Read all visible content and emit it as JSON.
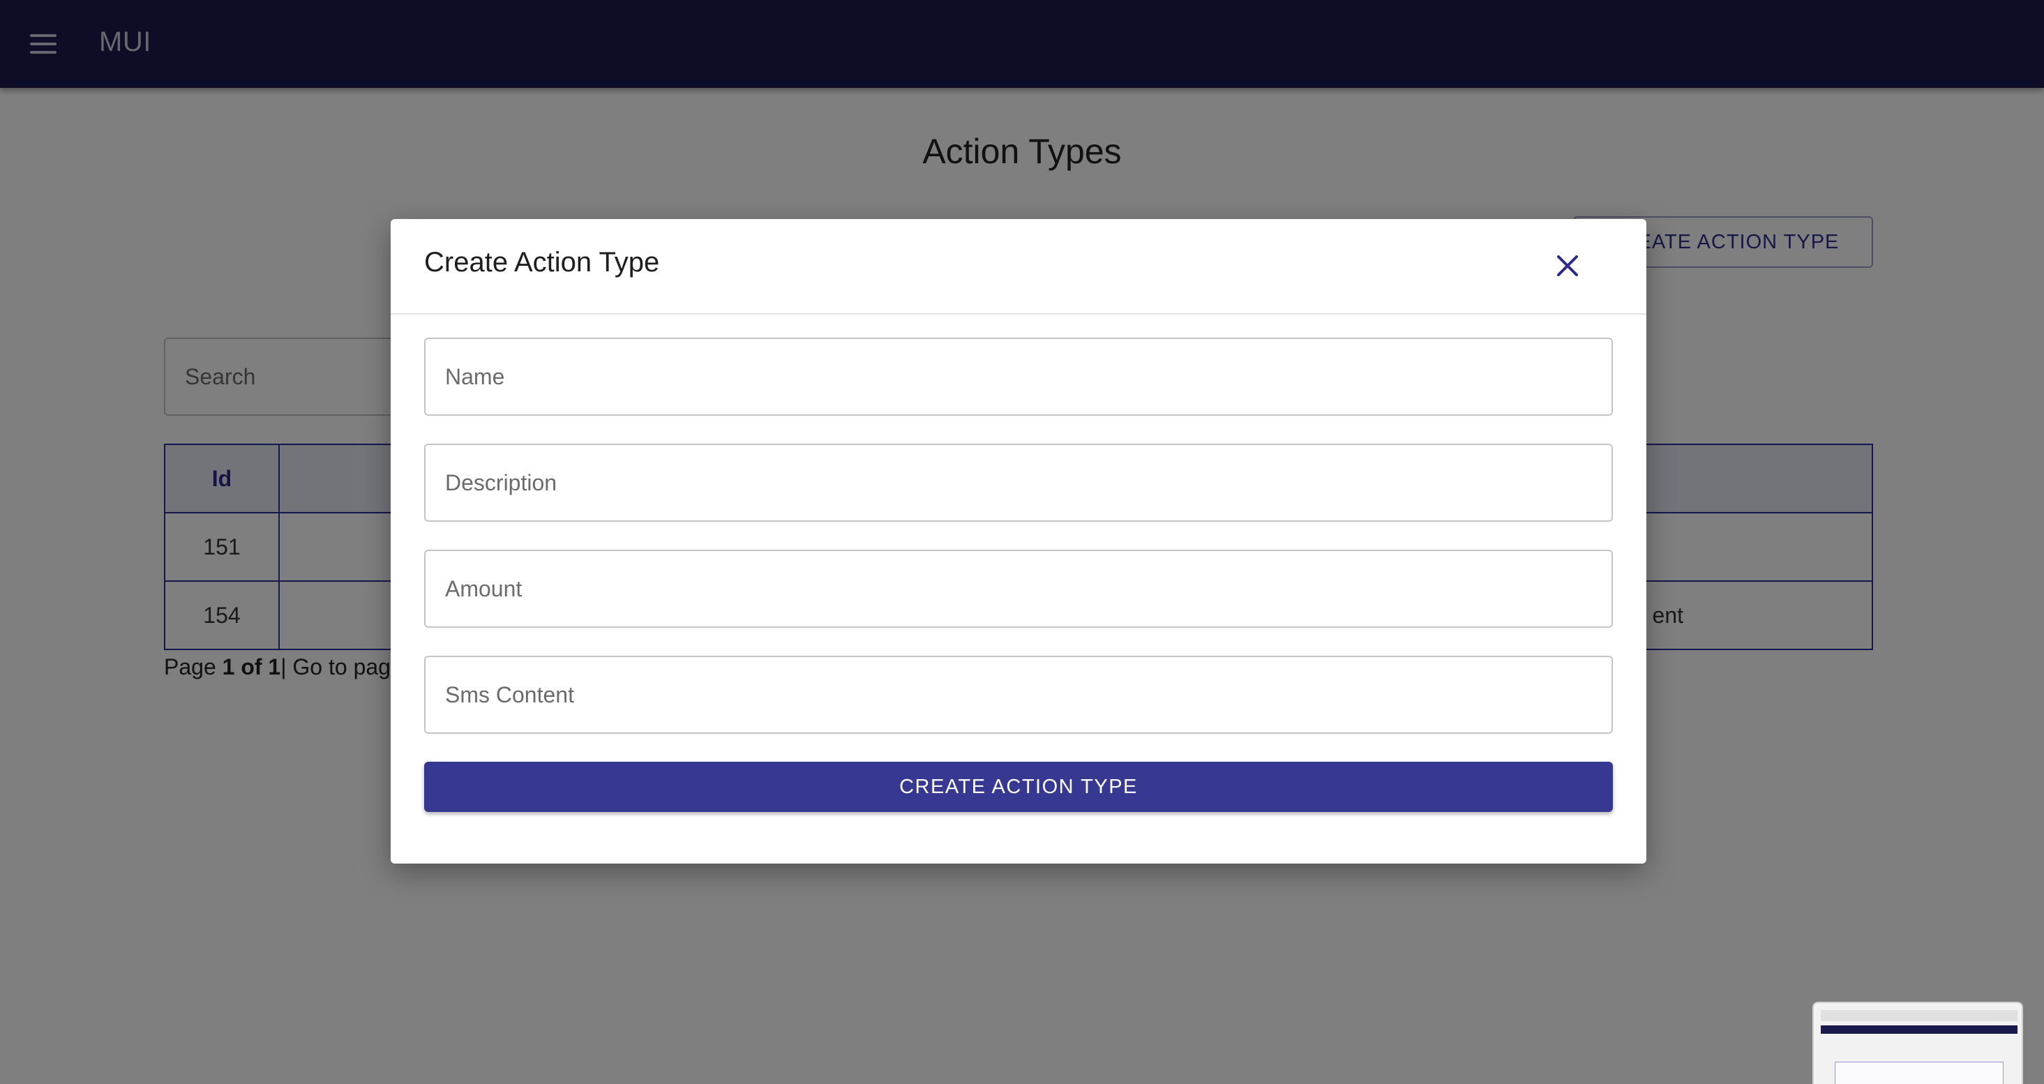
{
  "appbar": {
    "title": "MUI",
    "menu_icon": "menu-icon"
  },
  "page": {
    "title": "Action Types",
    "create_button_label": "CREATE ACTION TYPE",
    "search_placeholder": "Search",
    "table": {
      "headers": [
        "Id"
      ],
      "rows": [
        {
          "id": "151"
        },
        {
          "id": "154",
          "trailing_visible": "ent"
        }
      ]
    },
    "pagination": {
      "prefix": "Page ",
      "current": "1 of 1",
      "suffix": "| Go to pag"
    }
  },
  "modal": {
    "title": "Create Action Type",
    "close_icon": "close-icon",
    "fields": {
      "name_placeholder": "Name",
      "description_placeholder": "Description",
      "amount_placeholder": "Amount",
      "sms_content_placeholder": "Sms Content"
    },
    "submit_label": "CREATE ACTION TYPE"
  },
  "colors": {
    "appbar": "#1a1a4e",
    "primary_button": "#363891",
    "table_border": "#2a2aa0",
    "overlay": "rgba(0,0,0,0.5)"
  }
}
